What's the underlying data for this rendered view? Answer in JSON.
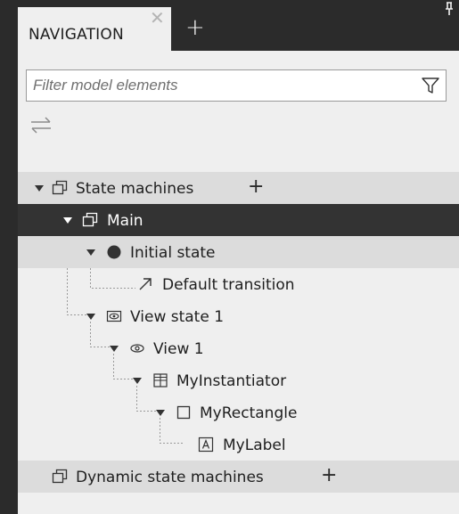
{
  "tabs": {
    "navigation_label": "NAVIGATION"
  },
  "filter": {
    "placeholder": "Filter model elements",
    "value": ""
  },
  "tree": {
    "state_machines": "State machines",
    "main": "Main",
    "initial_state": "Initial state",
    "default_transition": "Default transition",
    "view_state_1": "View state 1",
    "view_1": "View 1",
    "my_instantiator": "MyInstantiator",
    "my_rectangle": "MyRectangle",
    "my_label": "MyLabel",
    "dynamic_state_machines": "Dynamic state machines"
  },
  "colors": {
    "selection": "#333333",
    "group_row": "#dcdcdc",
    "panel": "#efefef",
    "chrome": "#2b2b2b"
  }
}
